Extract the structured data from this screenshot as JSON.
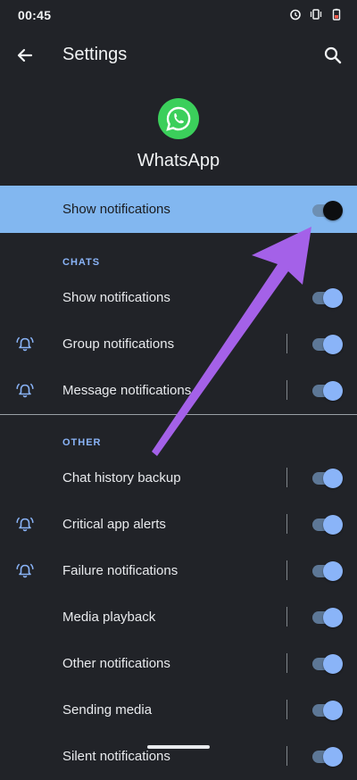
{
  "status_bar": {
    "time": "00:45"
  },
  "appbar": {
    "title": "Settings"
  },
  "app": {
    "name": "WhatsApp"
  },
  "master": {
    "label": "Show notifications",
    "enabled": false
  },
  "sections": {
    "chats": {
      "header": "CHATS"
    },
    "other": {
      "header": "OTHER"
    }
  },
  "rows": {
    "chats": [
      {
        "label": "Show notifications",
        "enabled": true
      },
      {
        "label": "Group notifications",
        "enabled": true
      },
      {
        "label": "Message notifications",
        "enabled": true
      }
    ],
    "other": [
      {
        "label": "Chat history backup",
        "enabled": true
      },
      {
        "label": "Critical app alerts",
        "enabled": true
      },
      {
        "label": "Failure notifications",
        "enabled": true
      },
      {
        "label": "Media playback",
        "enabled": true
      },
      {
        "label": "Other notifications",
        "enabled": true
      },
      {
        "label": "Sending media",
        "enabled": true
      },
      {
        "label": "Silent notifications",
        "enabled": true
      }
    ]
  },
  "colors": {
    "background": "#212328",
    "highlight": "#82b7f0",
    "accent": "#8ab4f8",
    "whatsapp_green": "#3bcf5b",
    "arrow": "#a461e8"
  },
  "icons": [
    "back-arrow-icon",
    "search-icon",
    "whatsapp-logo-icon",
    "bell-alert-icon",
    "alarm-icon",
    "vibrate-icon",
    "battery-icon"
  ]
}
